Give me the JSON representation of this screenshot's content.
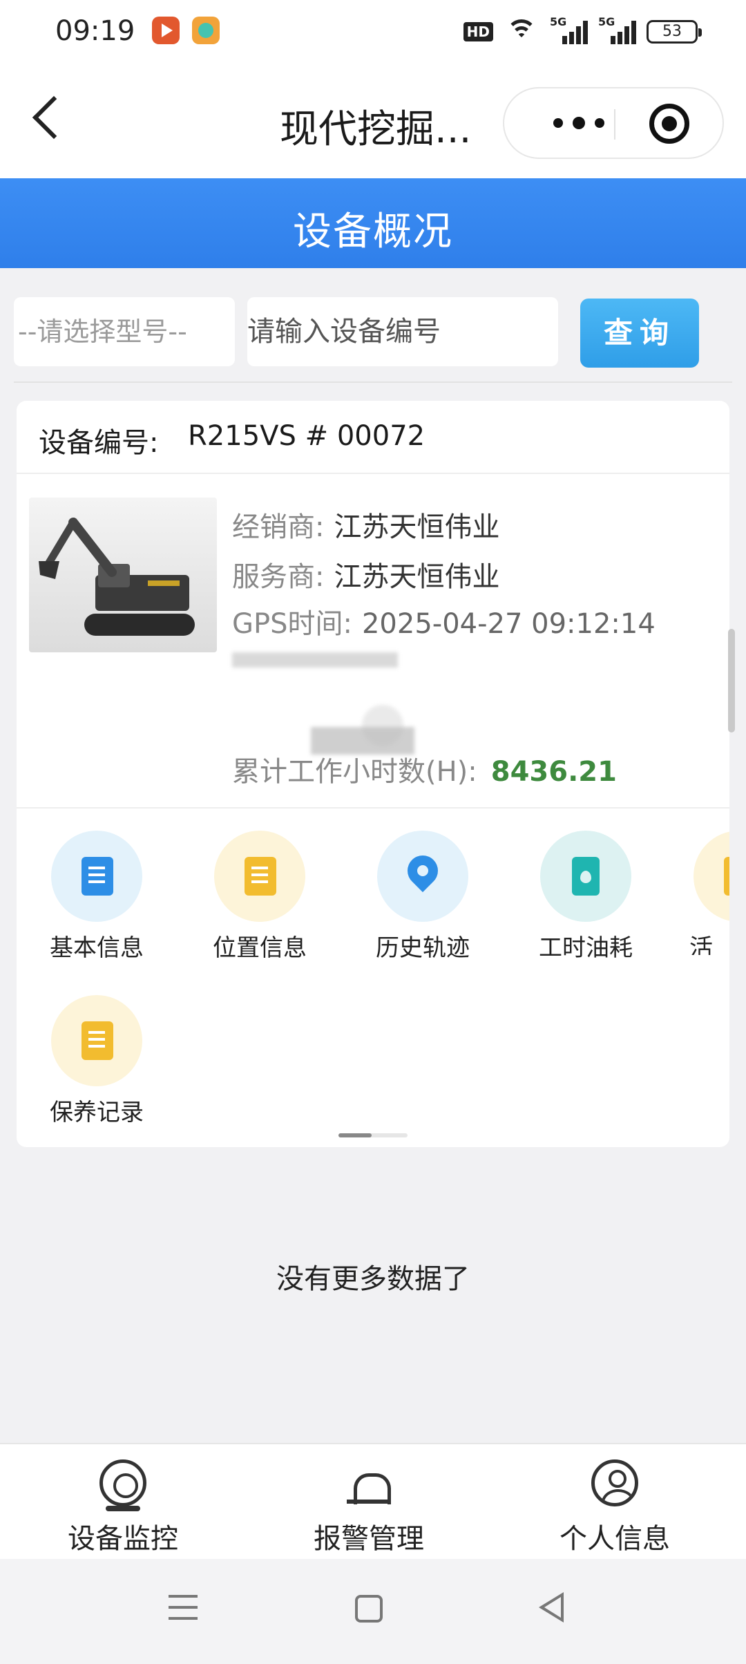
{
  "status_bar": {
    "time": "09:19",
    "hd": "HD",
    "signal_label": "5G",
    "battery": "53"
  },
  "title_bar": {
    "title": "现代挖掘..."
  },
  "header": {
    "title": "设备概况"
  },
  "search": {
    "model_placeholder": "--请选择型号--",
    "device_placeholder": "请输入设备编号",
    "query_label": "查询"
  },
  "device": {
    "number_label": "设备编号:",
    "number_value": "R215VS # 00072",
    "dealer_label": "经销商:",
    "dealer_value": "江苏天恒伟业",
    "service_label": "服务商:",
    "service_value": "江苏天恒伟业",
    "gps_label": "GPS时间:",
    "gps_value": "2025-04-27 09:12:14",
    "hours_label": "累计工作小时数(H):",
    "hours_value": "8436.21"
  },
  "menu": {
    "items": [
      {
        "label": "基本信息",
        "icon": "document-icon"
      },
      {
        "label": "位置信息",
        "icon": "document-icon"
      },
      {
        "label": "历史轨迹",
        "icon": "location-pin-icon"
      },
      {
        "label": "工时油耗",
        "icon": "fuel-drum-icon"
      },
      {
        "label": "活",
        "icon": "document-icon"
      },
      {
        "label": "保养记录",
        "icon": "document-icon"
      }
    ]
  },
  "list": {
    "no_more": "没有更多数据了"
  },
  "tabs": [
    {
      "label": "设备监控",
      "icon": "camera-icon"
    },
    {
      "label": "报警管理",
      "icon": "alarm-icon"
    },
    {
      "label": "个人信息",
      "icon": "person-icon"
    }
  ],
  "colors": {
    "accent_blue": "#2f7fea",
    "hours_green": "#3e8a3e"
  }
}
